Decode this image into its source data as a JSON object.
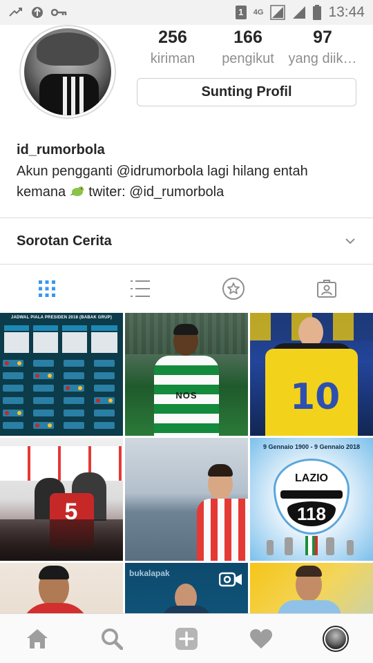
{
  "status_bar": {
    "time": "13:44",
    "sim_label": "1",
    "network": "4G",
    "icons": [
      "data-transfer-icon",
      "notification-icon",
      "key-icon",
      "sim-icon",
      "network-4g-icon",
      "signal-icon",
      "signal-icon",
      "battery-icon"
    ]
  },
  "profile": {
    "posts_count": "256",
    "posts_label": "kiriman",
    "followers_count": "166",
    "followers_label": "pengikut",
    "following_count": "97",
    "following_label": "yang diik…",
    "edit_button": "Sunting Profil",
    "username": "id_rumorbola",
    "bio_line1": "Akun pengganti @idrumorbola lagi hilang entah",
    "bio_line2_a": "kemana",
    "bio_line2_b": "twiter: @id_rumorbola"
  },
  "highlights": {
    "title": "Sorotan Cerita"
  },
  "tabs": [
    "grid-icon",
    "list-icon",
    "saved-star-icon",
    "tagged-icon"
  ],
  "grid": {
    "posts": [
      {
        "name": "post-jadwal-piala-presiden",
        "caption": "JADWAL PIALA PRESIDEN 2018 (BABAK GRUP)",
        "video": false
      },
      {
        "name": "post-sporting-player",
        "caption": "NOS",
        "video": false
      },
      {
        "name": "post-yellow-shirt-signing",
        "caption": "10",
        "video": false
      },
      {
        "name": "post-red-shirt-press",
        "caption": "5",
        "video": false
      },
      {
        "name": "post-player-seaside",
        "caption": "",
        "video": false
      },
      {
        "name": "post-lazio-anniversary",
        "caption": "9 Gennaio 1900 - 9 Gennaio 2018",
        "sub": "LAZIO",
        "num": "118",
        "video": false
      },
      {
        "name": "post-player-red-hoodie",
        "caption": "",
        "video": false
      },
      {
        "name": "post-bukalapak-players",
        "caption": "bukalapak",
        "video": true
      },
      {
        "name": "post-player-yellow-bg",
        "caption": "",
        "video": false
      }
    ]
  },
  "bottom_nav": [
    "home-icon",
    "search-icon",
    "add-post-icon",
    "activity-heart-icon",
    "profile-avatar"
  ],
  "colors": {
    "text": "#262626",
    "secondary_text": "#8e8e8e",
    "divider": "#dbdbdb",
    "active_tab": "#3897f0",
    "inactive_icon": "#8e8e8e"
  }
}
